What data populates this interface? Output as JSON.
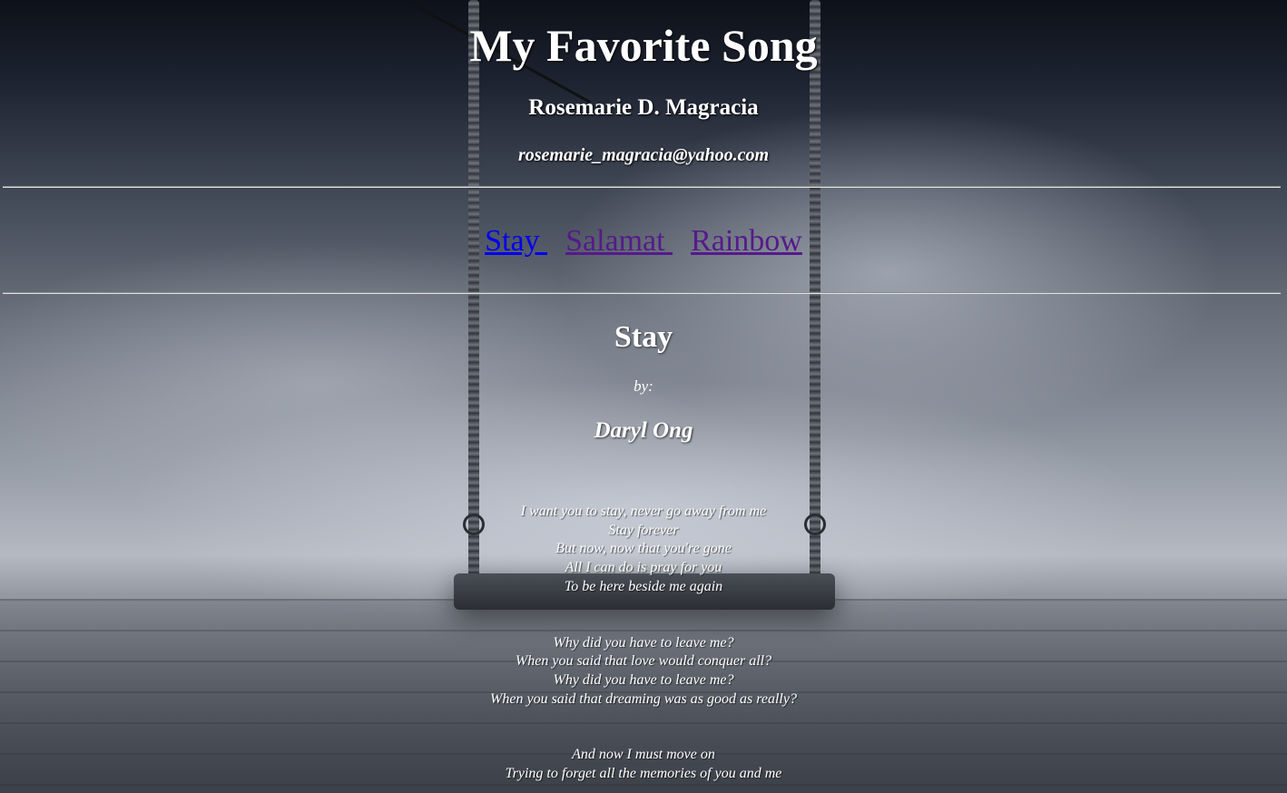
{
  "header": {
    "title": "My Favorite Song",
    "author": "Rosemarie D. Magracia",
    "email": "rosemarie_magracia@yahoo.com"
  },
  "nav": {
    "links": [
      {
        "label": "Stay ",
        "state": "current"
      },
      {
        "label": "Salamat ",
        "state": "visited"
      },
      {
        "label": "Rainbow",
        "state": "visited"
      }
    ]
  },
  "colors": {
    "link": "#0000ee",
    "visited_link": "#551a8b",
    "text": "#ffffff"
  },
  "song": {
    "title": "Stay",
    "by_label": "by:",
    "artist": "Daryl Ong",
    "stanzas": [
      [
        "I want you to stay, never go away from me",
        "Stay forever",
        "But now, now that you're gone",
        "All I can do is pray for you",
        "To be here beside me again"
      ],
      [
        "Why did you have to leave me?",
        "When you said that love would conquer all?",
        "Why did you have to leave me?",
        "When you said that dreaming was as good as really?"
      ],
      [
        "And now I must move on",
        "Trying to forget all the memories of you and me"
      ]
    ]
  },
  "background": {
    "icon": "swing-background-image"
  }
}
